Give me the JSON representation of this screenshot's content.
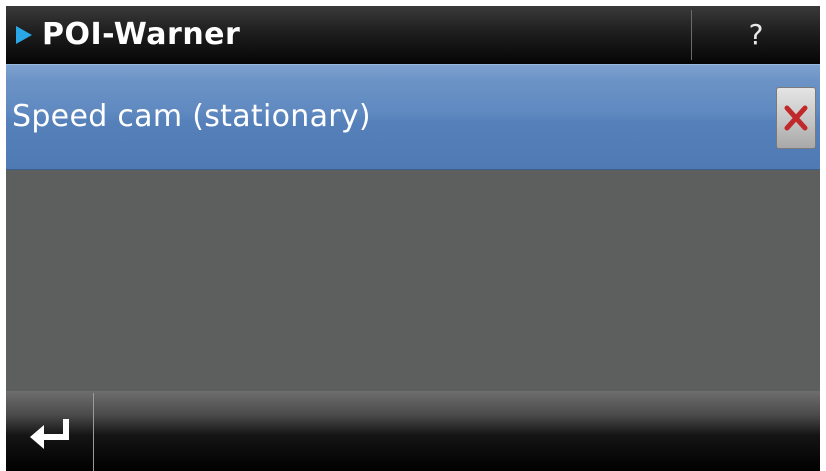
{
  "header": {
    "title": "POI-Warner",
    "help_label": "?",
    "arrow_icon": "play-arrow-icon",
    "arrow_color": "#2aa7e6"
  },
  "list": {
    "items": [
      {
        "label": "Speed cam (stationary)",
        "action_icon": "close-icon"
      }
    ],
    "selected_color": "#5f89c0"
  },
  "footer": {
    "back_icon": "return-arrow-icon"
  },
  "colors": {
    "background": "#5d5f5f",
    "delete_x": "#c0282a"
  }
}
